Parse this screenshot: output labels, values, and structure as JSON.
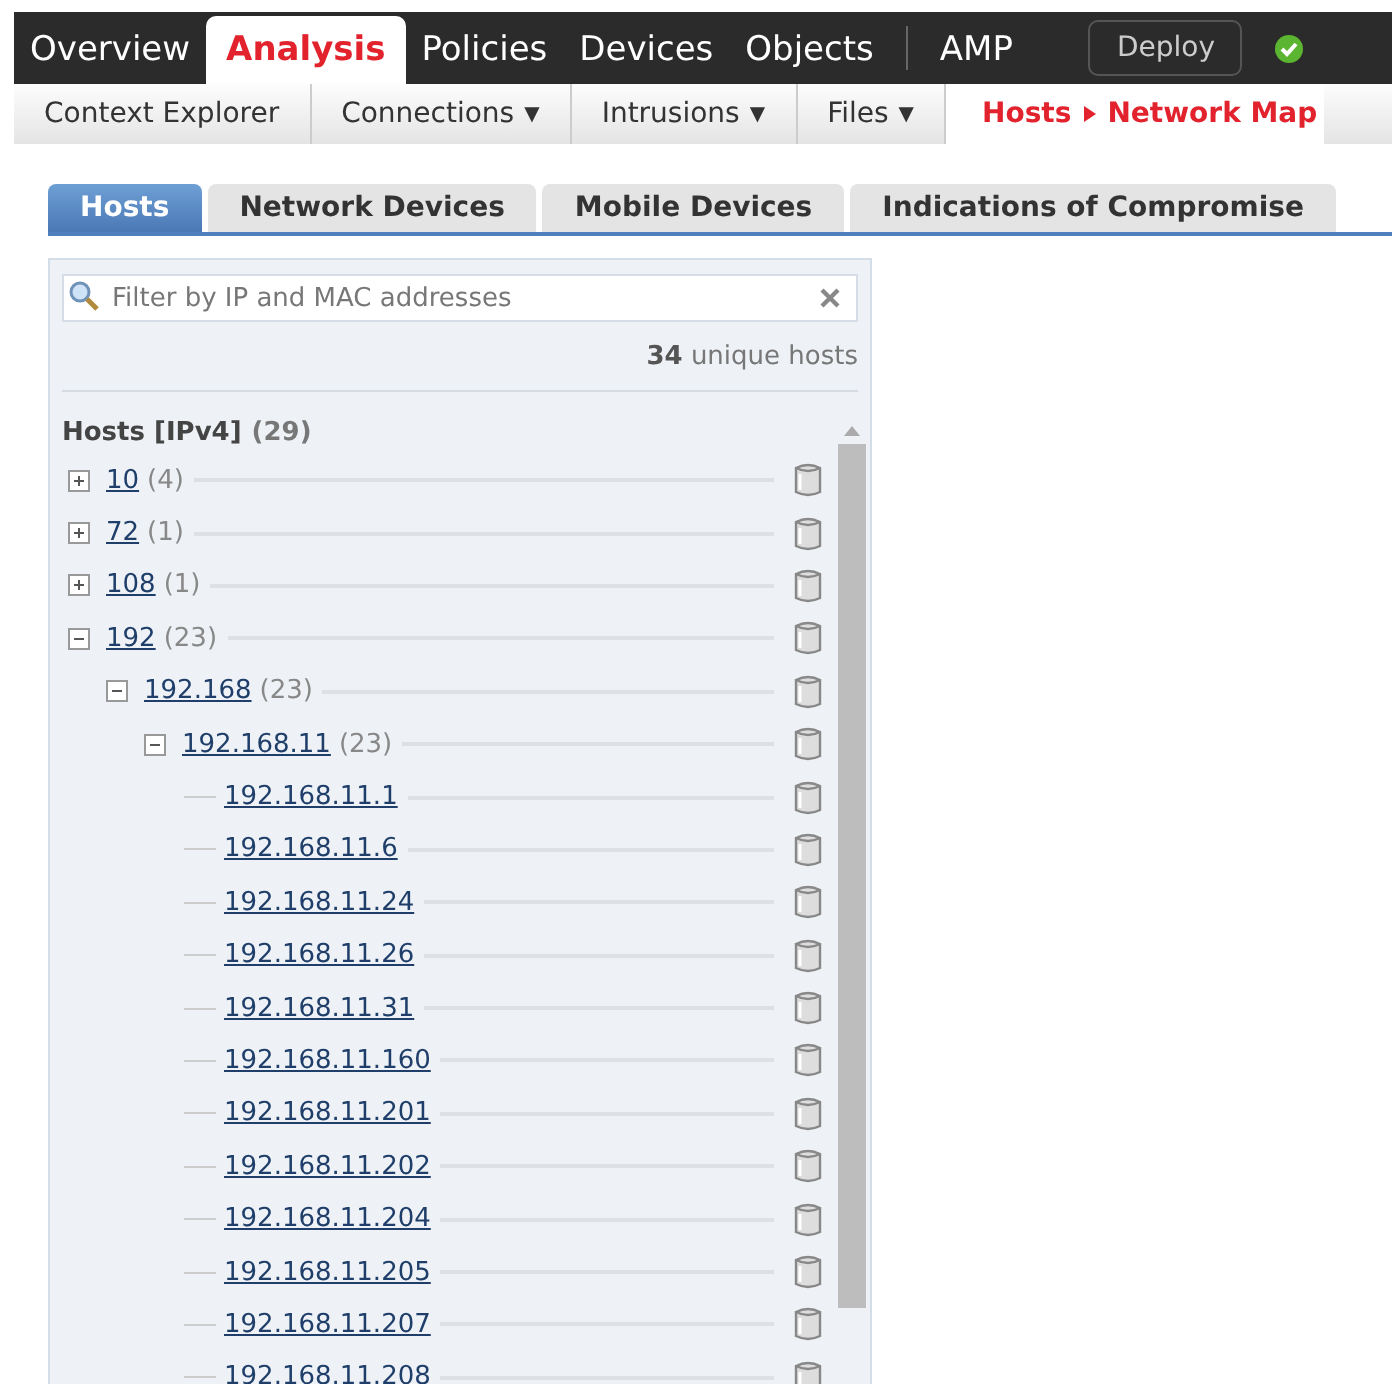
{
  "top_nav": {
    "items": [
      {
        "label": "Overview",
        "selected": false
      },
      {
        "label": "Analysis",
        "selected": true
      },
      {
        "label": "Policies",
        "selected": false
      },
      {
        "label": "Devices",
        "selected": false
      },
      {
        "label": "Objects",
        "selected": false
      },
      {
        "label": "AMP",
        "selected": false
      }
    ],
    "deploy_button": "Deploy"
  },
  "sub_nav": {
    "items": [
      {
        "label": "Context Explorer",
        "selected": false
      },
      {
        "label": "Connections",
        "caret": "▼",
        "selected": false
      },
      {
        "label": "Intrusions",
        "caret": "▼",
        "selected": false
      },
      {
        "label": "Files",
        "caret": "▼",
        "selected": false
      },
      {
        "label": "Hosts",
        "sublabel": "Network Map",
        "selected": true
      }
    ]
  },
  "tabs": [
    {
      "label": "Hosts",
      "selected": true
    },
    {
      "label": "Network Devices",
      "selected": false
    },
    {
      "label": "Mobile Devices",
      "selected": false
    },
    {
      "label": "Indications of Compromise",
      "selected": false
    }
  ],
  "filter": {
    "placeholder": "Filter by IP and MAC addresses"
  },
  "host_count": "**34** unique hosts",
  "tree": {
    "title": "Hosts [IPv4]",
    "count": "(29)",
    "nodes": [
      {
        "label": "10",
        "count": "(4)",
        "expanded": false
      },
      {
        "label": "72",
        "count": "(1)",
        "expanded": false
      },
      {
        "label": "108",
        "count": "(1)",
        "expanded": false
      },
      {
        "label": "192",
        "count": "(23)",
        "expanded": true,
        "children": [
          {
            "label": "192.168",
            "count": "(23)",
            "expanded": true,
            "children": [
              {
                "label": "192.168.11",
                "count": "(23)",
                "expanded": true,
                "children": [
                  {
                    "label": "192.168.11.1"
                  },
                  {
                    "label": "192.168.11.6"
                  },
                  {
                    "label": "192.168.11.24"
                  },
                  {
                    "label": "192.168.11.26"
                  },
                  {
                    "label": "192.168.11.31"
                  },
                  {
                    "label": "192.168.11.160"
                  },
                  {
                    "label": "192.168.11.201"
                  },
                  {
                    "label": "192.168.11.202"
                  },
                  {
                    "label": "192.168.11.204"
                  },
                  {
                    "label": "192.168.11.205"
                  },
                  {
                    "label": "192.168.11.207"
                  },
                  {
                    "label": "192.168.11.208"
                  }
                ]
              }
            ]
          }
        ]
      }
    ]
  }
}
